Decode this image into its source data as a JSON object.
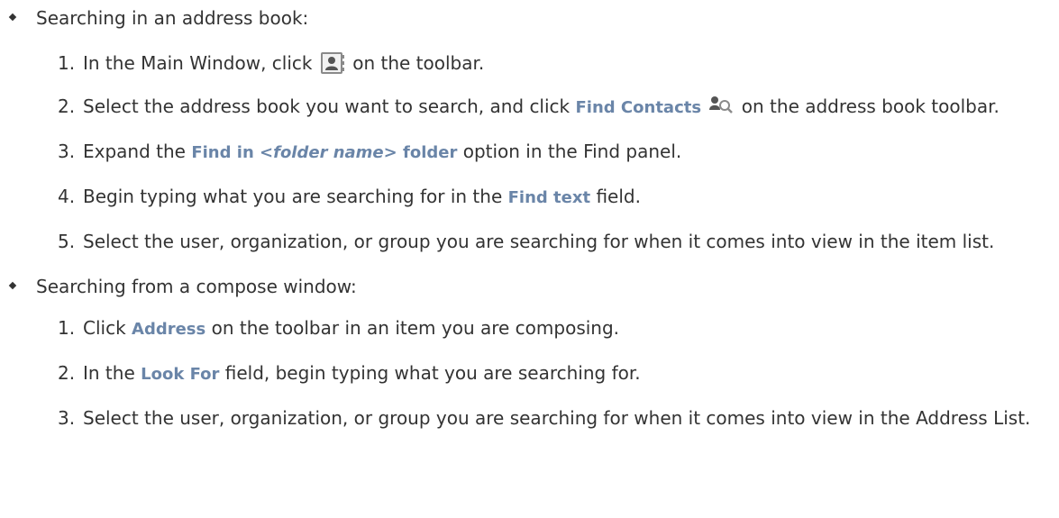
{
  "bullets": [
    {
      "label": "Searching in an address book:",
      "steps": [
        {
          "num": "1.",
          "pre": "In the Main Window, click",
          "icon": "address-book-icon",
          "post": "on the toolbar."
        },
        {
          "num": "2.",
          "pre": "Select the address book you want to search, and click",
          "ui": "Find Contacts",
          "icon": "find-contacts-icon",
          "post": "on the address book toolbar."
        },
        {
          "num": "3.",
          "pre": "Expand the",
          "ui_prefix": "Find in ",
          "ui_italic": "<folder name>",
          "ui_suffix": " folder",
          "post": "option in the Find panel."
        },
        {
          "num": "4.",
          "pre": "Begin typing what you are searching for in the",
          "ui": "Find text",
          "post": "field."
        },
        {
          "num": "5.",
          "text": "Select the user, organization, or group you are searching for when it comes into view in the item list."
        }
      ]
    },
    {
      "label": "Searching from a compose window:",
      "steps": [
        {
          "num": "1.",
          "pre": "Click",
          "ui": "Address",
          "post": "on the toolbar in an item you are composing."
        },
        {
          "num": "2.",
          "pre": "In the",
          "ui": "Look For",
          "post": "field, begin typing what you are searching for."
        },
        {
          "num": "3.",
          "text": "Select the user, organization, or group you are searching for when it comes into view in the Address List."
        }
      ]
    }
  ],
  "colors": {
    "text": "#333333",
    "ui_term": "#6a85a8"
  }
}
